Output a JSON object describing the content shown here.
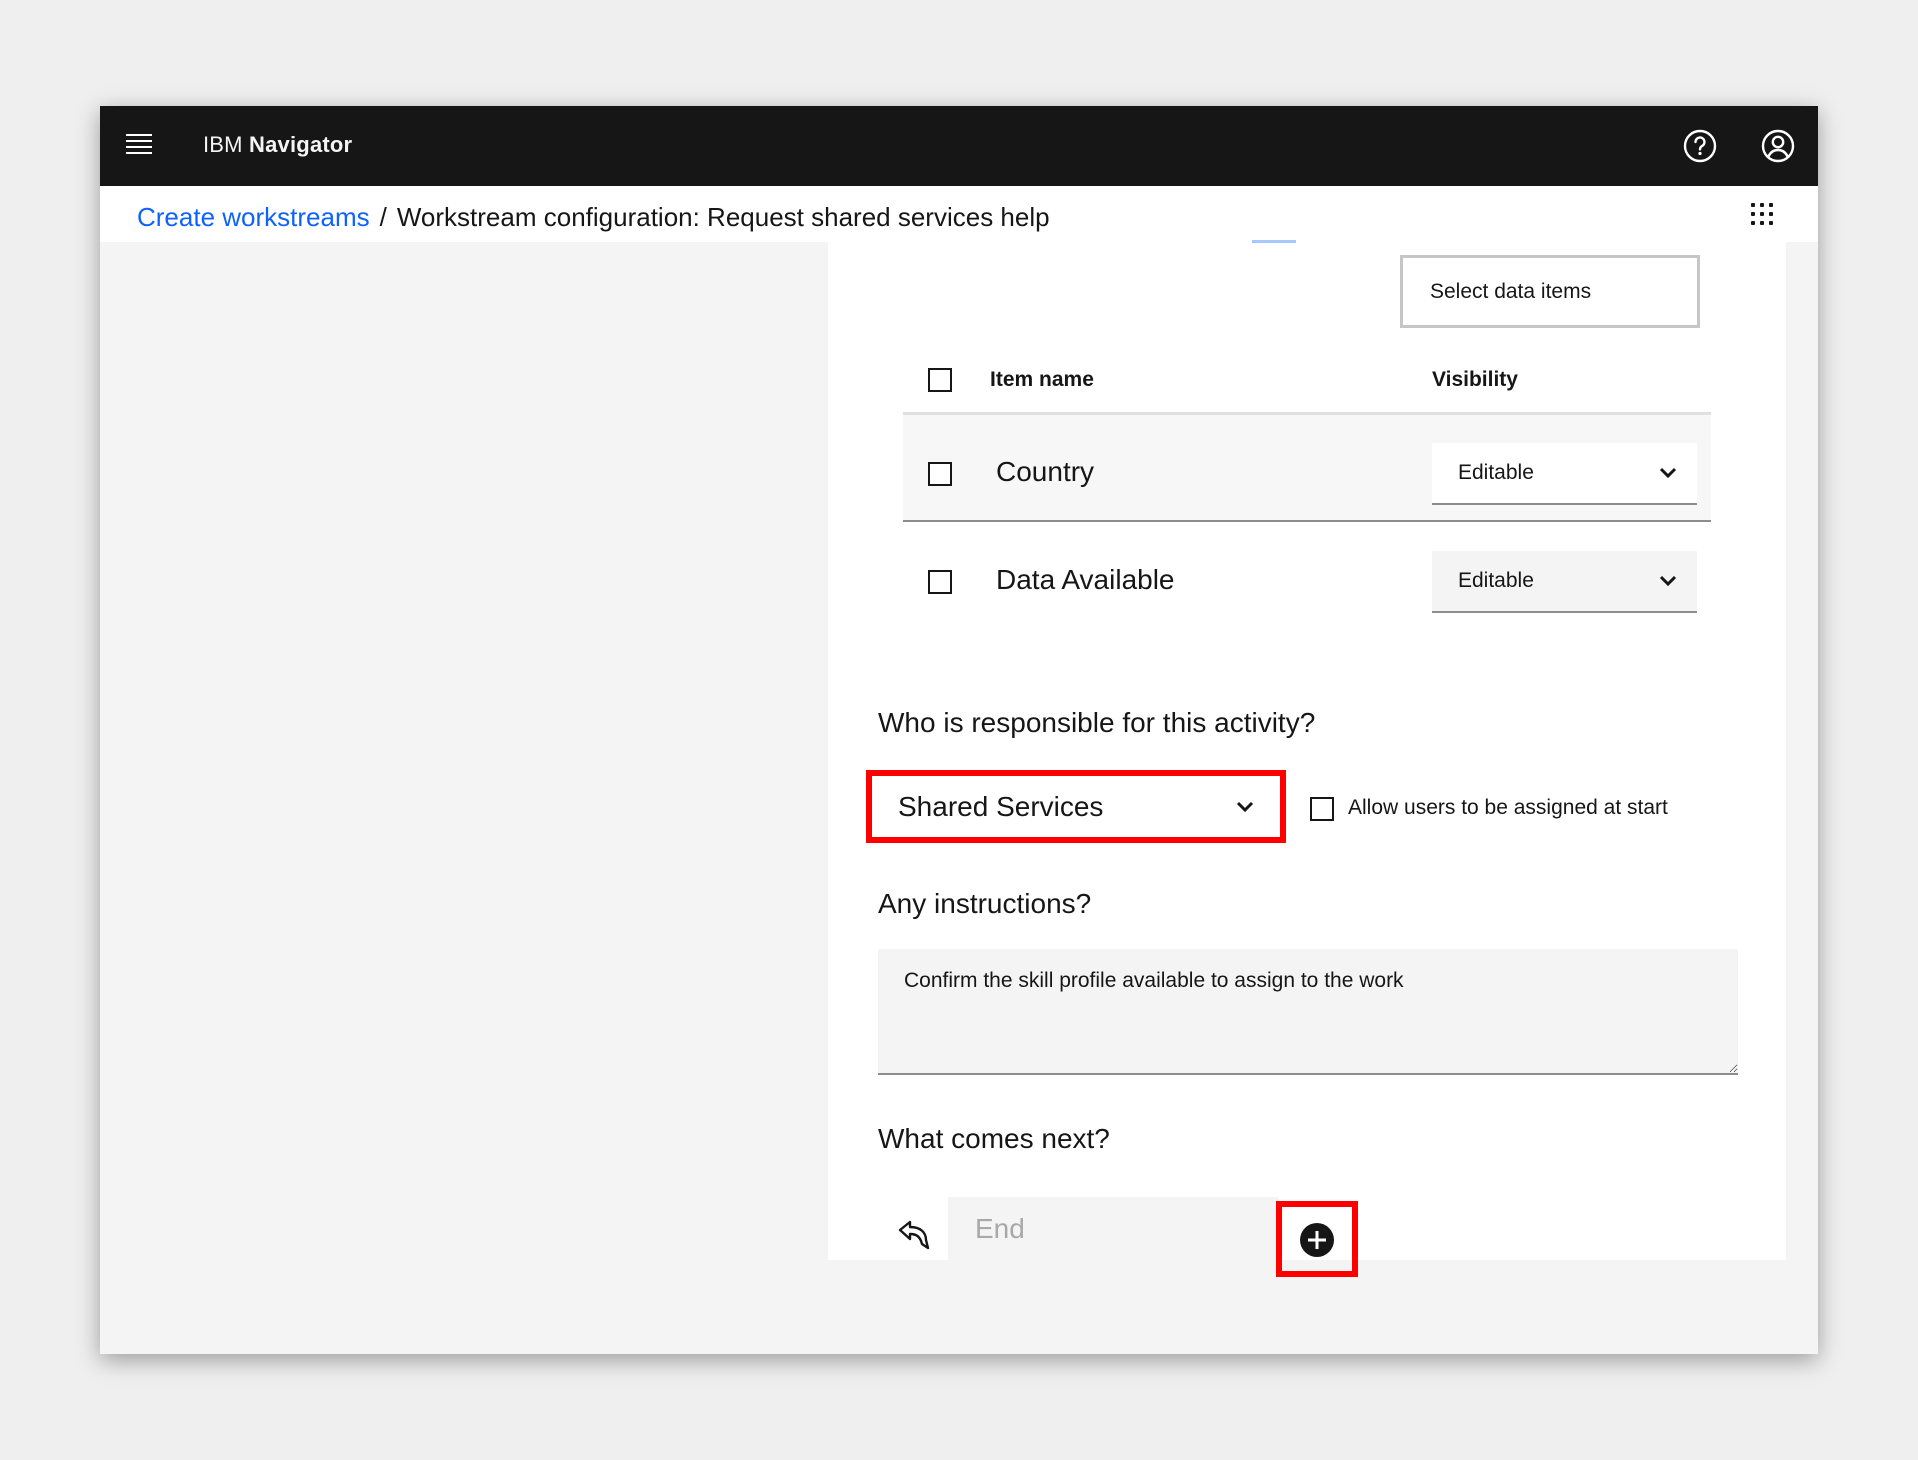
{
  "header": {
    "brand_prefix": "IBM",
    "brand_name": "Navigator",
    "menu_icon": "hamburger-icon",
    "help_icon": "help-icon",
    "user_icon": "user-icon"
  },
  "breadcrumb": {
    "parent": "Create workstreams",
    "separator": "/",
    "current": "Workstream configuration: Request shared services help",
    "apps_icon": "app-switcher-icon"
  },
  "data_items": {
    "select_button": "Select data items",
    "columns": [
      "Item name",
      "Visibility"
    ],
    "rows": [
      {
        "name": "Country",
        "visibility": "Editable"
      },
      {
        "name": "Data Available",
        "visibility": "Editable"
      }
    ]
  },
  "responsibility": {
    "question": "Who is responsible for this activity?",
    "selected": "Shared Services",
    "allow_label": "Allow users to be assigned at start"
  },
  "instructions": {
    "question": "Any instructions?",
    "value": "Confirm the skill profile available to assign to the work"
  },
  "next": {
    "question": "What comes next?",
    "value": "End",
    "flow_icon": "flow-arrow-icon",
    "add_icon": "add-circle-icon"
  },
  "colors": {
    "header_bg": "#161616",
    "link": "#0f62fe",
    "highlight": "#ff0000"
  }
}
